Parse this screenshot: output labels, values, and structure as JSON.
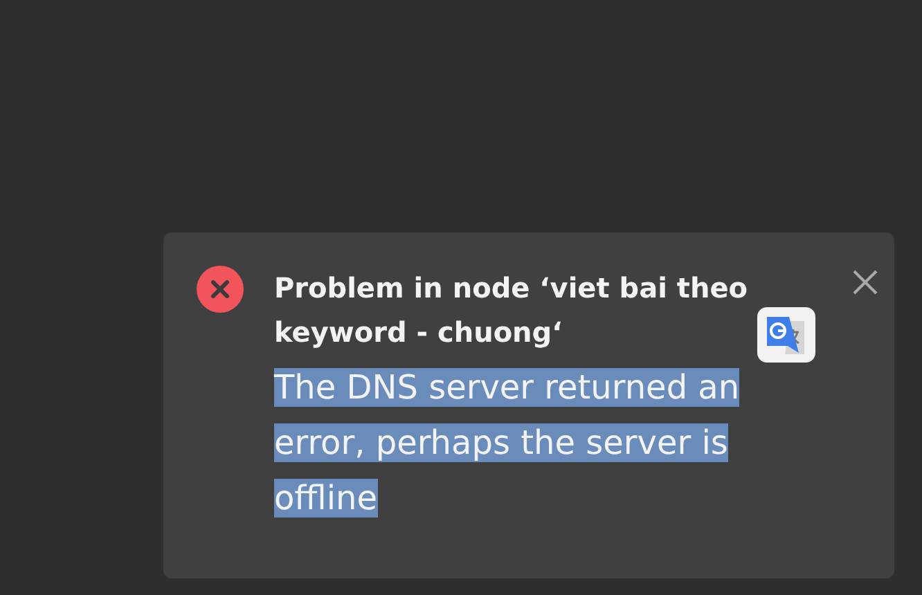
{
  "notification": {
    "kind": "error",
    "title": "Problem in node ‘viet bai theo keyword - chuong‘",
    "message": "The DNS server returned an error, perhaps the server is offline",
    "message_highlighted": true
  }
}
